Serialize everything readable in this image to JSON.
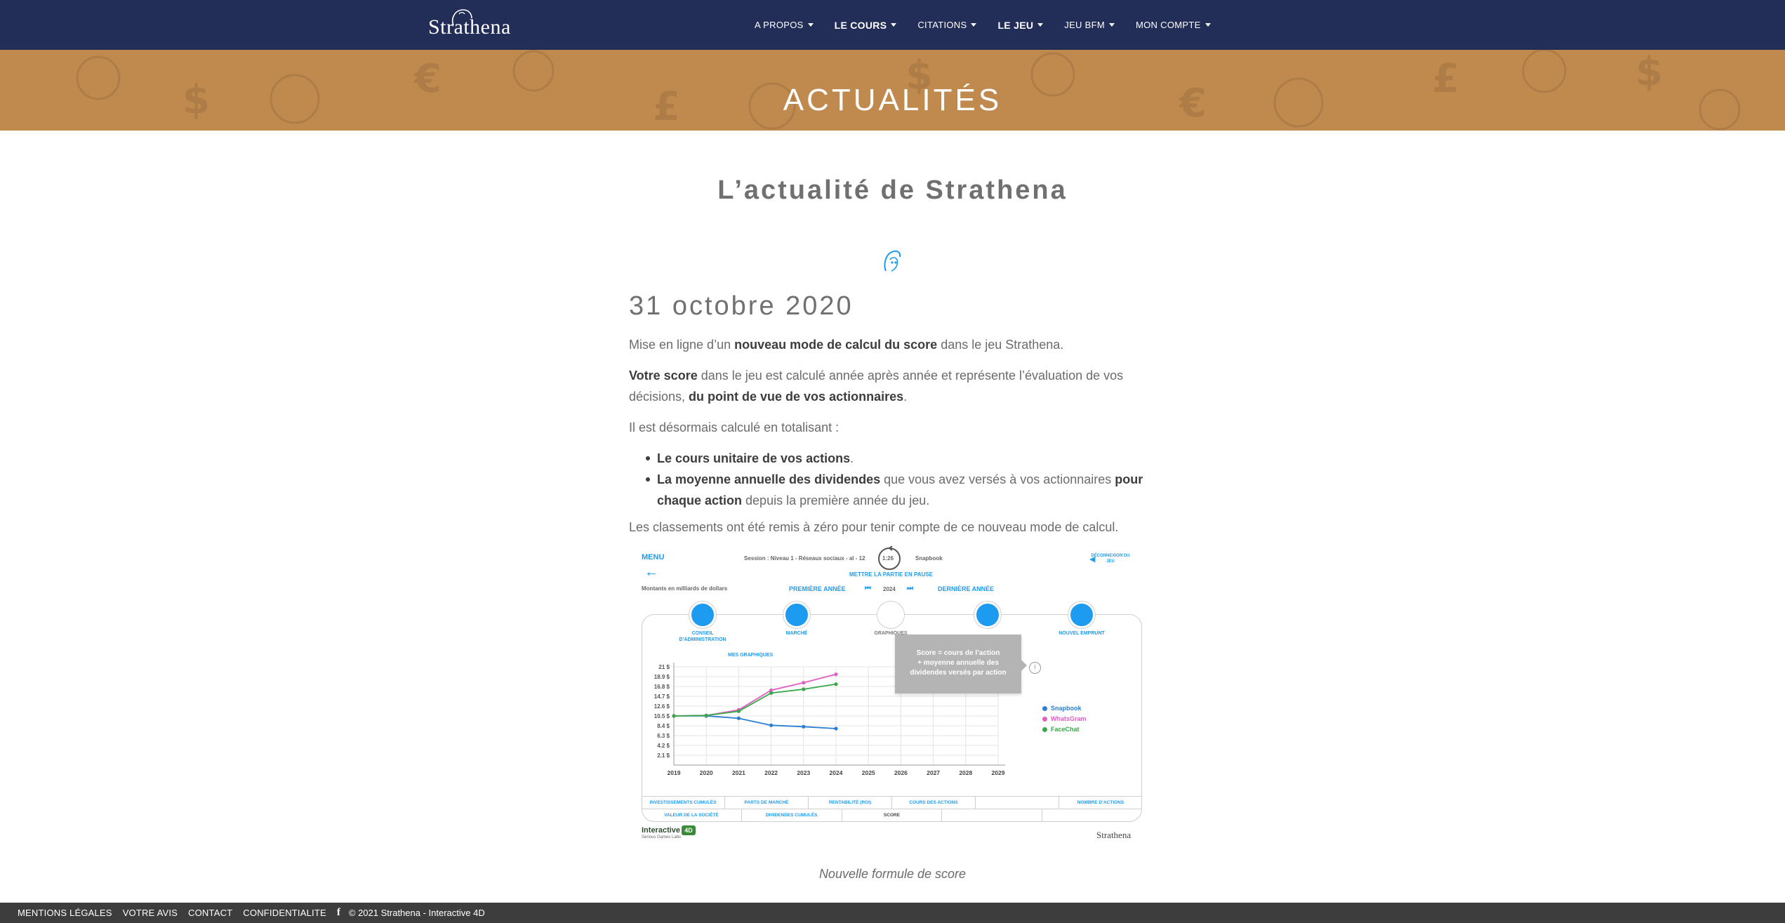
{
  "site": {
    "logo_text": "Strathena"
  },
  "nav": {
    "items": [
      {
        "label": "A PROPOS"
      },
      {
        "label": "LE COURS"
      },
      {
        "label": "CITATIONS"
      },
      {
        "label": "LE JEU"
      },
      {
        "label": "JEU BFM"
      },
      {
        "label": "MON COMPTE"
      }
    ]
  },
  "banner": {
    "title": "ACTUALITÉS"
  },
  "page": {
    "heading": "L’actualité de Strathena"
  },
  "article": {
    "date": "31 octobre 2020",
    "p1_a": "Mise en ligne d’un ",
    "p1_b": "nouveau mode de calcul du score",
    "p1_c": " dans le jeu Strathena.",
    "p2_a": "Votre score",
    "p2_b": " dans le jeu est calculé année après année et représente l’évaluation de vos décisions, ",
    "p2_c": "du point de vue de vos actionnaires",
    "p2_d": ".",
    "p3": "Il est désormais calculé en totalisant :",
    "b1_a": "Le cours unitaire de vos actions",
    "b1_b": ".",
    "b2_a": "La moyenne annuelle des dividendes",
    "b2_b": " que vous avez versés à vos actionnaires ",
    "b2_c": "pour chaque action",
    "b2_d": " depuis la première année du jeu.",
    "p4": "Les classements ont été remis à zéro pour tenir compte de ce nouveau mode de calcul.",
    "caption": "Nouvelle formule de score"
  },
  "game": {
    "menu": "MENU",
    "session": "Session : Niveau 1 - Réseaux sociaux - al - 12",
    "timer": "1:26",
    "company": "Snapbook",
    "disconnect": "DÉCONNEXION DU JEU",
    "pause": "METTRE LA PARTIE EN PAUSE",
    "amounts_note": "Montants en milliards de dollars",
    "first_year": "PREMIÈRE ANNÉE",
    "current_year": "2024",
    "last_year": "DERNIÈRE ANNÉE",
    "circles": [
      {
        "label": "CONSEIL D’ADMINISTRATION"
      },
      {
        "label": "MARCHÉ"
      },
      {
        "label": "GRAPHIQUES"
      },
      {
        "label": ""
      },
      {
        "label": "NOUVEL EMPRUNT"
      }
    ],
    "my_charts": "MES GRAPHIQUES",
    "tooltip_line1": "Score = cours de l’action",
    "tooltip_line2": "+ moyenne annuelle des",
    "tooltip_line3": "dividendes versés par action",
    "table_row1": [
      "INVESTISSEMENTS CUMULÉS",
      "PARTS DE MARCHÉ",
      "RENTABILITÉ (ROI)",
      "COURS DES ACTIONS",
      "",
      "NOMBRE D’ACTIONS"
    ],
    "table_row2": [
      "VALEUR DE LA SOCIÉTÉ",
      "DIVIDENDES CUMULÉS",
      "SCORE",
      "",
      ""
    ],
    "brand": "Interactive",
    "brand_badge": "4D",
    "brand_sub": "Serious Games Labs",
    "corner_logo": "Strathena"
  },
  "chart_data": {
    "type": "line",
    "x": [
      2019,
      2020,
      2021,
      2022,
      2023,
      2024,
      2025,
      2026,
      2027,
      2028,
      2029
    ],
    "ytick_labels": [
      "2.1 $",
      "4.2 $",
      "6.3 $",
      "8.4 $",
      "10.5 $",
      "12.6 $",
      "14.7 $",
      "16.8 $",
      "18.9 $",
      "21 $"
    ],
    "ylim": [
      0,
      21
    ],
    "grid": true,
    "legend_position": "right",
    "series": [
      {
        "name": "Snapbook",
        "color": "#2a7fd4",
        "values": [
          10.5,
          10.5,
          10,
          8.5,
          8.2,
          7.8
        ]
      },
      {
        "name": "WhatsGram",
        "color": "#e05fc4",
        "values": [
          10.5,
          10.6,
          11.8,
          16,
          17.6,
          19.4
        ]
      },
      {
        "name": "FaceChat",
        "color": "#3aa84a",
        "values": [
          10.5,
          10.6,
          11.5,
          15.4,
          16.2,
          17.3
        ]
      }
    ]
  }
}
